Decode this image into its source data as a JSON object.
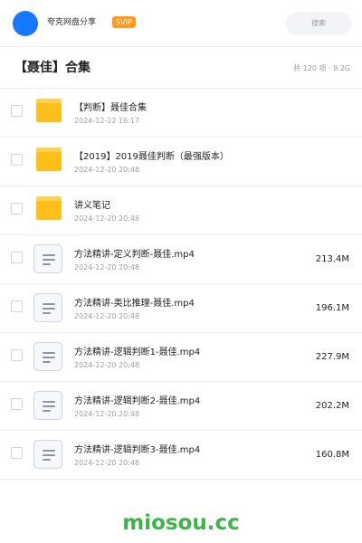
{
  "header": {
    "username": "夸克网盘分享",
    "badge": "SVIP",
    "search_placeholder": "搜索"
  },
  "page": {
    "title": "【聂佳】合集",
    "meta": "共 120 项 · 9.2G"
  },
  "items": [
    {
      "type": "folder",
      "name": "【判断】聂佳合集",
      "date": "2024-12-22 16:17",
      "size": ""
    },
    {
      "type": "folder",
      "name": "【2019】2019聂佳判断（最强版本）",
      "date": "2024-12-20 20:48",
      "size": ""
    },
    {
      "type": "folder",
      "name": "讲义笔记",
      "date": "2024-12-20 20:48",
      "size": ""
    },
    {
      "type": "file",
      "name": "方法精讲-定义判断-聂佳.mp4",
      "date": "2024-12-20 20:48",
      "size": "213.4M"
    },
    {
      "type": "file",
      "name": "方法精讲-类比推理-聂佳.mp4",
      "date": "2024-12-20 20:48",
      "size": "196.1M"
    },
    {
      "type": "file",
      "name": "方法精讲-逻辑判断1-聂佳.mp4",
      "date": "2024-12-20 20:48",
      "size": "227.9M"
    },
    {
      "type": "file",
      "name": "方法精讲-逻辑判断2-聂佳.mp4",
      "date": "2024-12-20 20:48",
      "size": "202.2M"
    },
    {
      "type": "file",
      "name": "方法精讲-逻辑判断3-聂佳.mp4",
      "date": "2024-12-20 20:48",
      "size": "160.8M"
    }
  ],
  "icons": {
    "folder": "folder-icon",
    "file": "video-file-icon"
  },
  "colors": {
    "brand": "#1677ff",
    "badge": "#ff9a1f",
    "folder": "#ffbf1a",
    "watermark": "#3cb449"
  },
  "watermark": "miosou.cc"
}
